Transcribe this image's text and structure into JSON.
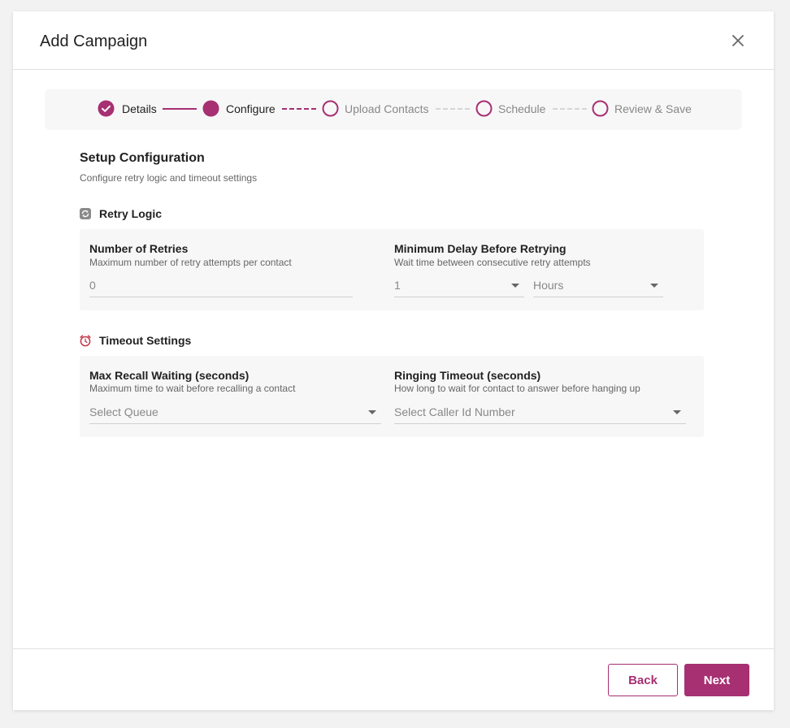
{
  "modal": {
    "title": "Add Campaign",
    "close_icon": "close-icon"
  },
  "stepper": {
    "steps": [
      {
        "label": "Details",
        "state": "completed"
      },
      {
        "label": "Configure",
        "state": "current"
      },
      {
        "label": "Upload Contacts",
        "state": "pending"
      },
      {
        "label": "Schedule",
        "state": "pending"
      },
      {
        "label": "Review & Save",
        "state": "pending"
      }
    ]
  },
  "setup": {
    "title": "Setup Configuration",
    "subtitle": "Configure retry logic and timeout settings"
  },
  "retry_logic": {
    "title": "Retry Logic",
    "icon": "retry-icon",
    "retries": {
      "label": "Number of Retries",
      "help": "Maximum number of retry attempts per contact",
      "value": "0"
    },
    "min_delay": {
      "label": "Minimum Delay Before Retrying",
      "help": "Wait time between consecutive retry attempts",
      "value": "1",
      "unit": "Hours"
    }
  },
  "timeout_settings": {
    "title": "Timeout Settings",
    "icon": "alarm-clock-icon",
    "max_recall": {
      "label": "Max Recall Waiting (seconds)",
      "help": "Maximum time to wait before recalling a contact",
      "placeholder": "Select Queue"
    },
    "ringing_timeout": {
      "label": "Ringing Timeout (seconds)",
      "help": "How long to wait for contact to answer before hanging up",
      "placeholder": "Select Caller Id Number"
    }
  },
  "footer": {
    "back_label": "Back",
    "next_label": "Next"
  },
  "colors": {
    "accent": "#a63072",
    "background": "#f2f2f2",
    "card": "#f7f7f7"
  }
}
